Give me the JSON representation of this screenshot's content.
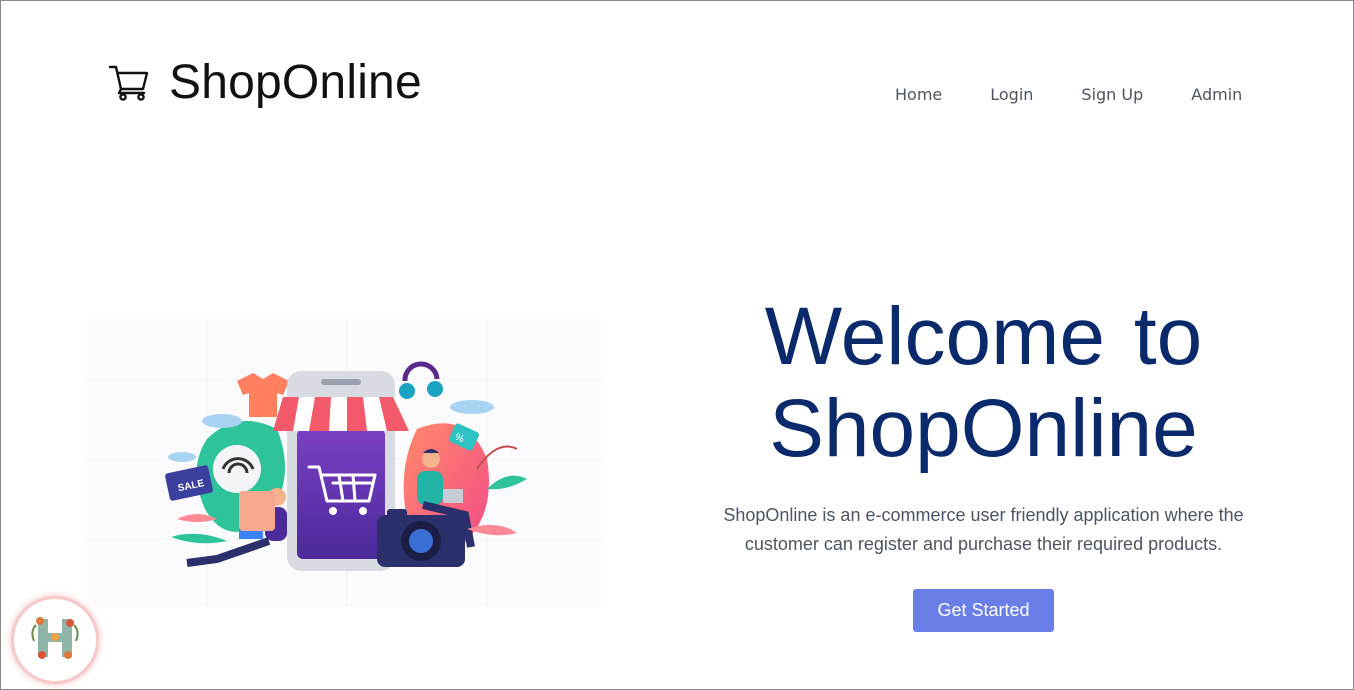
{
  "header": {
    "brand_name": "ShopOnline",
    "logo_icon": "shopping-cart-icon"
  },
  "nav": {
    "items": [
      {
        "label": "Home"
      },
      {
        "label": "Login"
      },
      {
        "label": "Sign Up"
      },
      {
        "label": "Admin"
      }
    ]
  },
  "hero": {
    "title": "Welcome to ShopOnline",
    "description": "ShopOnline is an e-commerce user friendly application where the customer can register and purchase their required products.",
    "cta_label": "Get Started",
    "image_icon": "online-shopping-illustration",
    "sale_tag": "SALE"
  },
  "colors": {
    "title": "#0b2a6b",
    "cta": "#6a7ee8",
    "nav_text": "#4b5563"
  },
  "badge": {
    "icon": "floral-h-monogram-icon"
  }
}
